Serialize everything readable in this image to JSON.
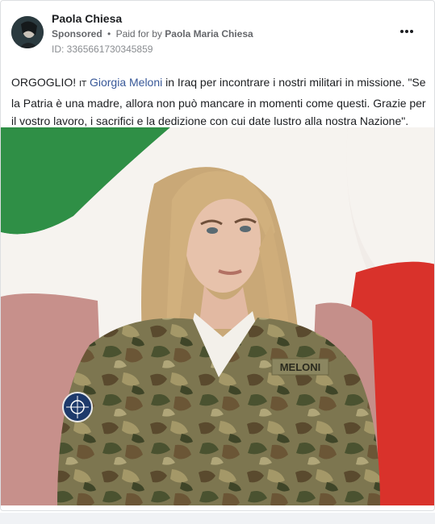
{
  "post": {
    "author": "Paola Chiesa",
    "sponsored_label": "Sponsored",
    "separator": "•",
    "paid_for_prefix": "Paid for by",
    "paid_for_by": "Paola Maria Chiesa",
    "ad_id": "ID: 3365661730345859",
    "text_prefix": "ORGOGLIO! ",
    "flag_emoji": "IT",
    "mention": "Giorgia Meloni",
    "text_suffix": " in Iraq per incontrare i nostri militari in missione. \"Se la Patria è una madre, allora non può mancare in momenti come questi. Grazie per il vostro lavoro, i sacrifici e la dedizione con cui date lustro alla nostra Nazione\".",
    "more_icon": "more-horizontal-icon",
    "image_badge_text": "MELONI"
  },
  "colors": {
    "mention": "#385898",
    "meta": "#65676b",
    "flag_green": "#2f8f46",
    "flag_red": "#d9322b",
    "camo_base": "#7f7a4d"
  }
}
